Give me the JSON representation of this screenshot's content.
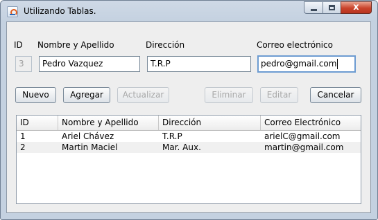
{
  "window": {
    "title": "Utilizando Tablas.",
    "close_symbol": "x"
  },
  "form": {
    "id_label": "ID",
    "name_label": "Nombre y Apellido",
    "address_label": "Dirección",
    "email_label": "Correo electrónico",
    "id_value": "3",
    "name_value": "Pedro Vazquez",
    "address_value": "T.R.P",
    "email_value": "pedro@gmail.com"
  },
  "buttons": {
    "nuevo": "Nuevo",
    "agregar": "Agregar",
    "actualizar": "Actualizar",
    "eliminar": "Eliminar",
    "editar": "Editar",
    "cancelar": "Cancelar"
  },
  "table": {
    "headers": [
      "ID",
      "Nombre y Apellido",
      "Dirección",
      "Correo Electrónico"
    ],
    "rows": [
      [
        "1",
        "Ariel Chávez",
        "T.R.P",
        "arielC@gmail.com"
      ],
      [
        "2",
        "Martin Maciel",
        "Mar. Aux.",
        "martin@gmail.com"
      ]
    ]
  }
}
